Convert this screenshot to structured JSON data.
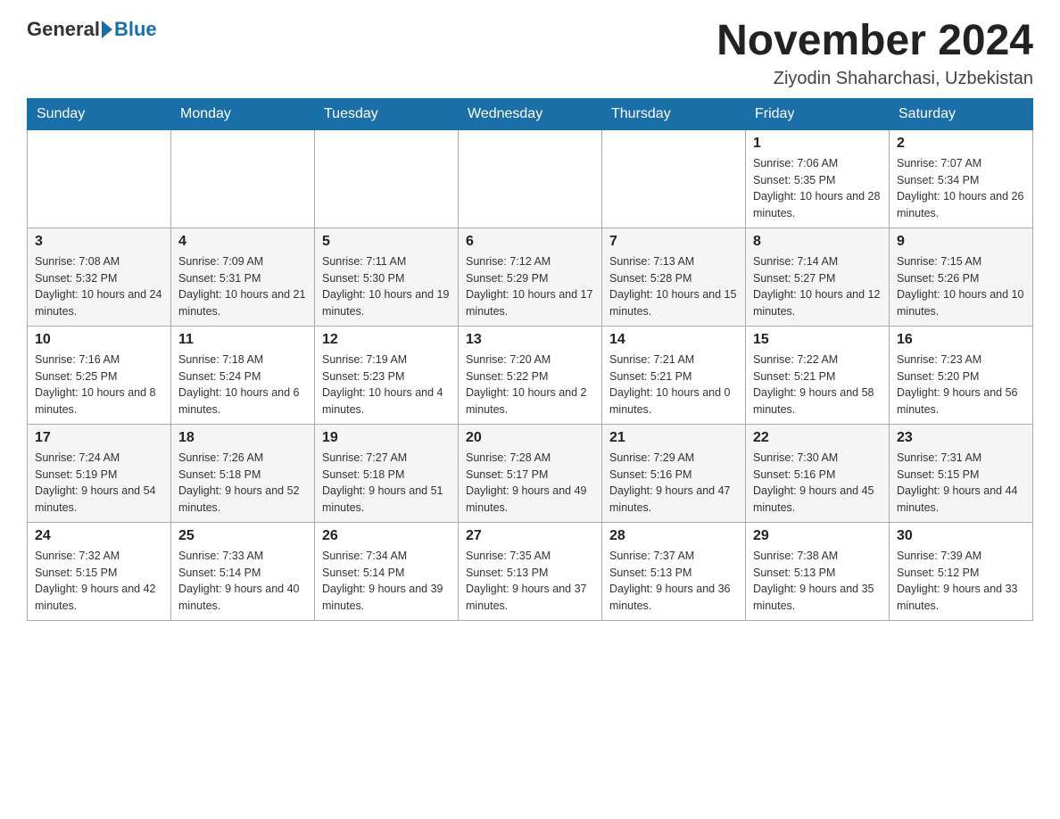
{
  "header": {
    "logo_general": "General",
    "logo_blue": "Blue",
    "month_title": "November 2024",
    "location": "Ziyodin Shaharchasi, Uzbekistan"
  },
  "days_of_week": [
    "Sunday",
    "Monday",
    "Tuesday",
    "Wednesday",
    "Thursday",
    "Friday",
    "Saturday"
  ],
  "weeks": [
    [
      {
        "day": "",
        "info": ""
      },
      {
        "day": "",
        "info": ""
      },
      {
        "day": "",
        "info": ""
      },
      {
        "day": "",
        "info": ""
      },
      {
        "day": "",
        "info": ""
      },
      {
        "day": "1",
        "info": "Sunrise: 7:06 AM\nSunset: 5:35 PM\nDaylight: 10 hours and 28 minutes."
      },
      {
        "day": "2",
        "info": "Sunrise: 7:07 AM\nSunset: 5:34 PM\nDaylight: 10 hours and 26 minutes."
      }
    ],
    [
      {
        "day": "3",
        "info": "Sunrise: 7:08 AM\nSunset: 5:32 PM\nDaylight: 10 hours and 24 minutes."
      },
      {
        "day": "4",
        "info": "Sunrise: 7:09 AM\nSunset: 5:31 PM\nDaylight: 10 hours and 21 minutes."
      },
      {
        "day": "5",
        "info": "Sunrise: 7:11 AM\nSunset: 5:30 PM\nDaylight: 10 hours and 19 minutes."
      },
      {
        "day": "6",
        "info": "Sunrise: 7:12 AM\nSunset: 5:29 PM\nDaylight: 10 hours and 17 minutes."
      },
      {
        "day": "7",
        "info": "Sunrise: 7:13 AM\nSunset: 5:28 PM\nDaylight: 10 hours and 15 minutes."
      },
      {
        "day": "8",
        "info": "Sunrise: 7:14 AM\nSunset: 5:27 PM\nDaylight: 10 hours and 12 minutes."
      },
      {
        "day": "9",
        "info": "Sunrise: 7:15 AM\nSunset: 5:26 PM\nDaylight: 10 hours and 10 minutes."
      }
    ],
    [
      {
        "day": "10",
        "info": "Sunrise: 7:16 AM\nSunset: 5:25 PM\nDaylight: 10 hours and 8 minutes."
      },
      {
        "day": "11",
        "info": "Sunrise: 7:18 AM\nSunset: 5:24 PM\nDaylight: 10 hours and 6 minutes."
      },
      {
        "day": "12",
        "info": "Sunrise: 7:19 AM\nSunset: 5:23 PM\nDaylight: 10 hours and 4 minutes."
      },
      {
        "day": "13",
        "info": "Sunrise: 7:20 AM\nSunset: 5:22 PM\nDaylight: 10 hours and 2 minutes."
      },
      {
        "day": "14",
        "info": "Sunrise: 7:21 AM\nSunset: 5:21 PM\nDaylight: 10 hours and 0 minutes."
      },
      {
        "day": "15",
        "info": "Sunrise: 7:22 AM\nSunset: 5:21 PM\nDaylight: 9 hours and 58 minutes."
      },
      {
        "day": "16",
        "info": "Sunrise: 7:23 AM\nSunset: 5:20 PM\nDaylight: 9 hours and 56 minutes."
      }
    ],
    [
      {
        "day": "17",
        "info": "Sunrise: 7:24 AM\nSunset: 5:19 PM\nDaylight: 9 hours and 54 minutes."
      },
      {
        "day": "18",
        "info": "Sunrise: 7:26 AM\nSunset: 5:18 PM\nDaylight: 9 hours and 52 minutes."
      },
      {
        "day": "19",
        "info": "Sunrise: 7:27 AM\nSunset: 5:18 PM\nDaylight: 9 hours and 51 minutes."
      },
      {
        "day": "20",
        "info": "Sunrise: 7:28 AM\nSunset: 5:17 PM\nDaylight: 9 hours and 49 minutes."
      },
      {
        "day": "21",
        "info": "Sunrise: 7:29 AM\nSunset: 5:16 PM\nDaylight: 9 hours and 47 minutes."
      },
      {
        "day": "22",
        "info": "Sunrise: 7:30 AM\nSunset: 5:16 PM\nDaylight: 9 hours and 45 minutes."
      },
      {
        "day": "23",
        "info": "Sunrise: 7:31 AM\nSunset: 5:15 PM\nDaylight: 9 hours and 44 minutes."
      }
    ],
    [
      {
        "day": "24",
        "info": "Sunrise: 7:32 AM\nSunset: 5:15 PM\nDaylight: 9 hours and 42 minutes."
      },
      {
        "day": "25",
        "info": "Sunrise: 7:33 AM\nSunset: 5:14 PM\nDaylight: 9 hours and 40 minutes."
      },
      {
        "day": "26",
        "info": "Sunrise: 7:34 AM\nSunset: 5:14 PM\nDaylight: 9 hours and 39 minutes."
      },
      {
        "day": "27",
        "info": "Sunrise: 7:35 AM\nSunset: 5:13 PM\nDaylight: 9 hours and 37 minutes."
      },
      {
        "day": "28",
        "info": "Sunrise: 7:37 AM\nSunset: 5:13 PM\nDaylight: 9 hours and 36 minutes."
      },
      {
        "day": "29",
        "info": "Sunrise: 7:38 AM\nSunset: 5:13 PM\nDaylight: 9 hours and 35 minutes."
      },
      {
        "day": "30",
        "info": "Sunrise: 7:39 AM\nSunset: 5:12 PM\nDaylight: 9 hours and 33 minutes."
      }
    ]
  ]
}
